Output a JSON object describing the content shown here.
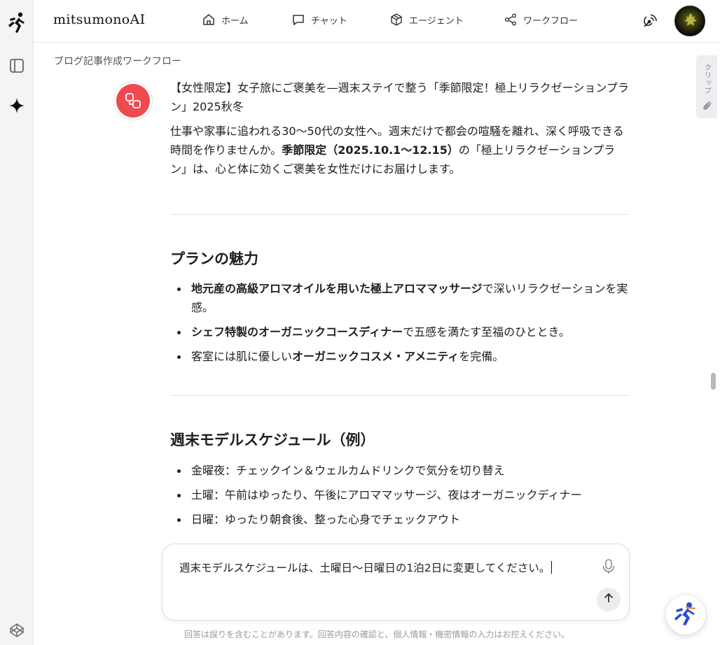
{
  "app": {
    "brand": "mitsumonoAI"
  },
  "nav": [
    {
      "label": "ホーム",
      "icon": "home-icon"
    },
    {
      "label": "チャット",
      "icon": "chat-icon"
    },
    {
      "label": "エージェント",
      "icon": "cube-icon"
    },
    {
      "label": "ワークフロー",
      "icon": "share-icon"
    }
  ],
  "breadcrumb": "ブログ記事作成ワークフロー",
  "clip_tab": {
    "label": "クリップ"
  },
  "message": {
    "title": "【女性限定】女子旅にご褒美を—週末ステイで整う「季節限定！極上リラクゼーションプラン」2025秋冬",
    "intro": {
      "part1": "仕事や家事に追われる30〜50代の女性へ。週末だけで都会の喧騒を離れ、深く呼吸できる時間を作りませんか。",
      "bold": "季節限定（2025.10.1〜12.15）",
      "part2": "の「極上リラクゼーションプラン」は、心と体に効くご褒美を女性だけにお届けします。"
    },
    "section1": {
      "heading": "プランの魅力",
      "items": [
        {
          "pre": "",
          "bold": "地元産の高級アロマオイルを用いた極上アロママッサージ",
          "post": "で深いリラクゼーションを実感。"
        },
        {
          "pre": "",
          "bold": "シェフ特製のオーガニックコースディナー",
          "post": "で五感を満たす至福のひととき。"
        },
        {
          "pre": "客室には肌に優しい",
          "bold": "オーガニックコスメ・アメニティ",
          "post": "を完備。"
        }
      ]
    },
    "section2": {
      "heading": "週末モデルスケジュール（例）",
      "items": [
        "金曜夜：チェックイン＆ウェルカムドリンクで気分を切り替え",
        "土曜：午前はゆったり、午後にアロママッサージ、夜はオーガニックディナー",
        "日曜：ゆったり朝食後、整った心身でチェックアウト"
      ]
    }
  },
  "composer": {
    "value": "週末モデルスケジュールは、土曜日〜日曜日の1泊2日に変更してください。"
  },
  "disclaimer": "回答は誤りを含むことがあります。回答内容の確認と、個人情報・機密情報の入力はお控えください。",
  "colors": {
    "accent_red": "#ef4a4f",
    "fab_blue": "#2a4bd1",
    "fab_orange": "#f07a1a"
  }
}
